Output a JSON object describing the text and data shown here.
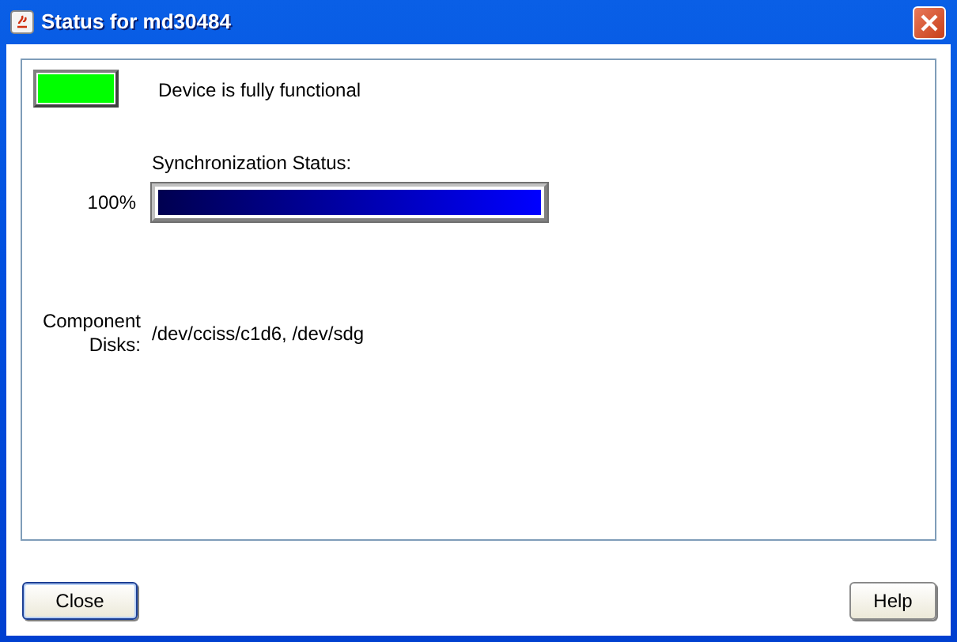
{
  "window": {
    "title": "Status for md30484"
  },
  "status": {
    "color": "#00ff00",
    "text": "Device is fully functional"
  },
  "sync": {
    "label": "Synchronization Status:",
    "percent": "100%",
    "level": 1.0
  },
  "component_disks": {
    "label": "Component Disks:",
    "value": "/dev/cciss/c1d6, /dev/sdg"
  },
  "buttons": [
    {
      "label": "Close",
      "focused": true
    },
    {
      "label": "Help",
      "focused": false
    }
  ]
}
